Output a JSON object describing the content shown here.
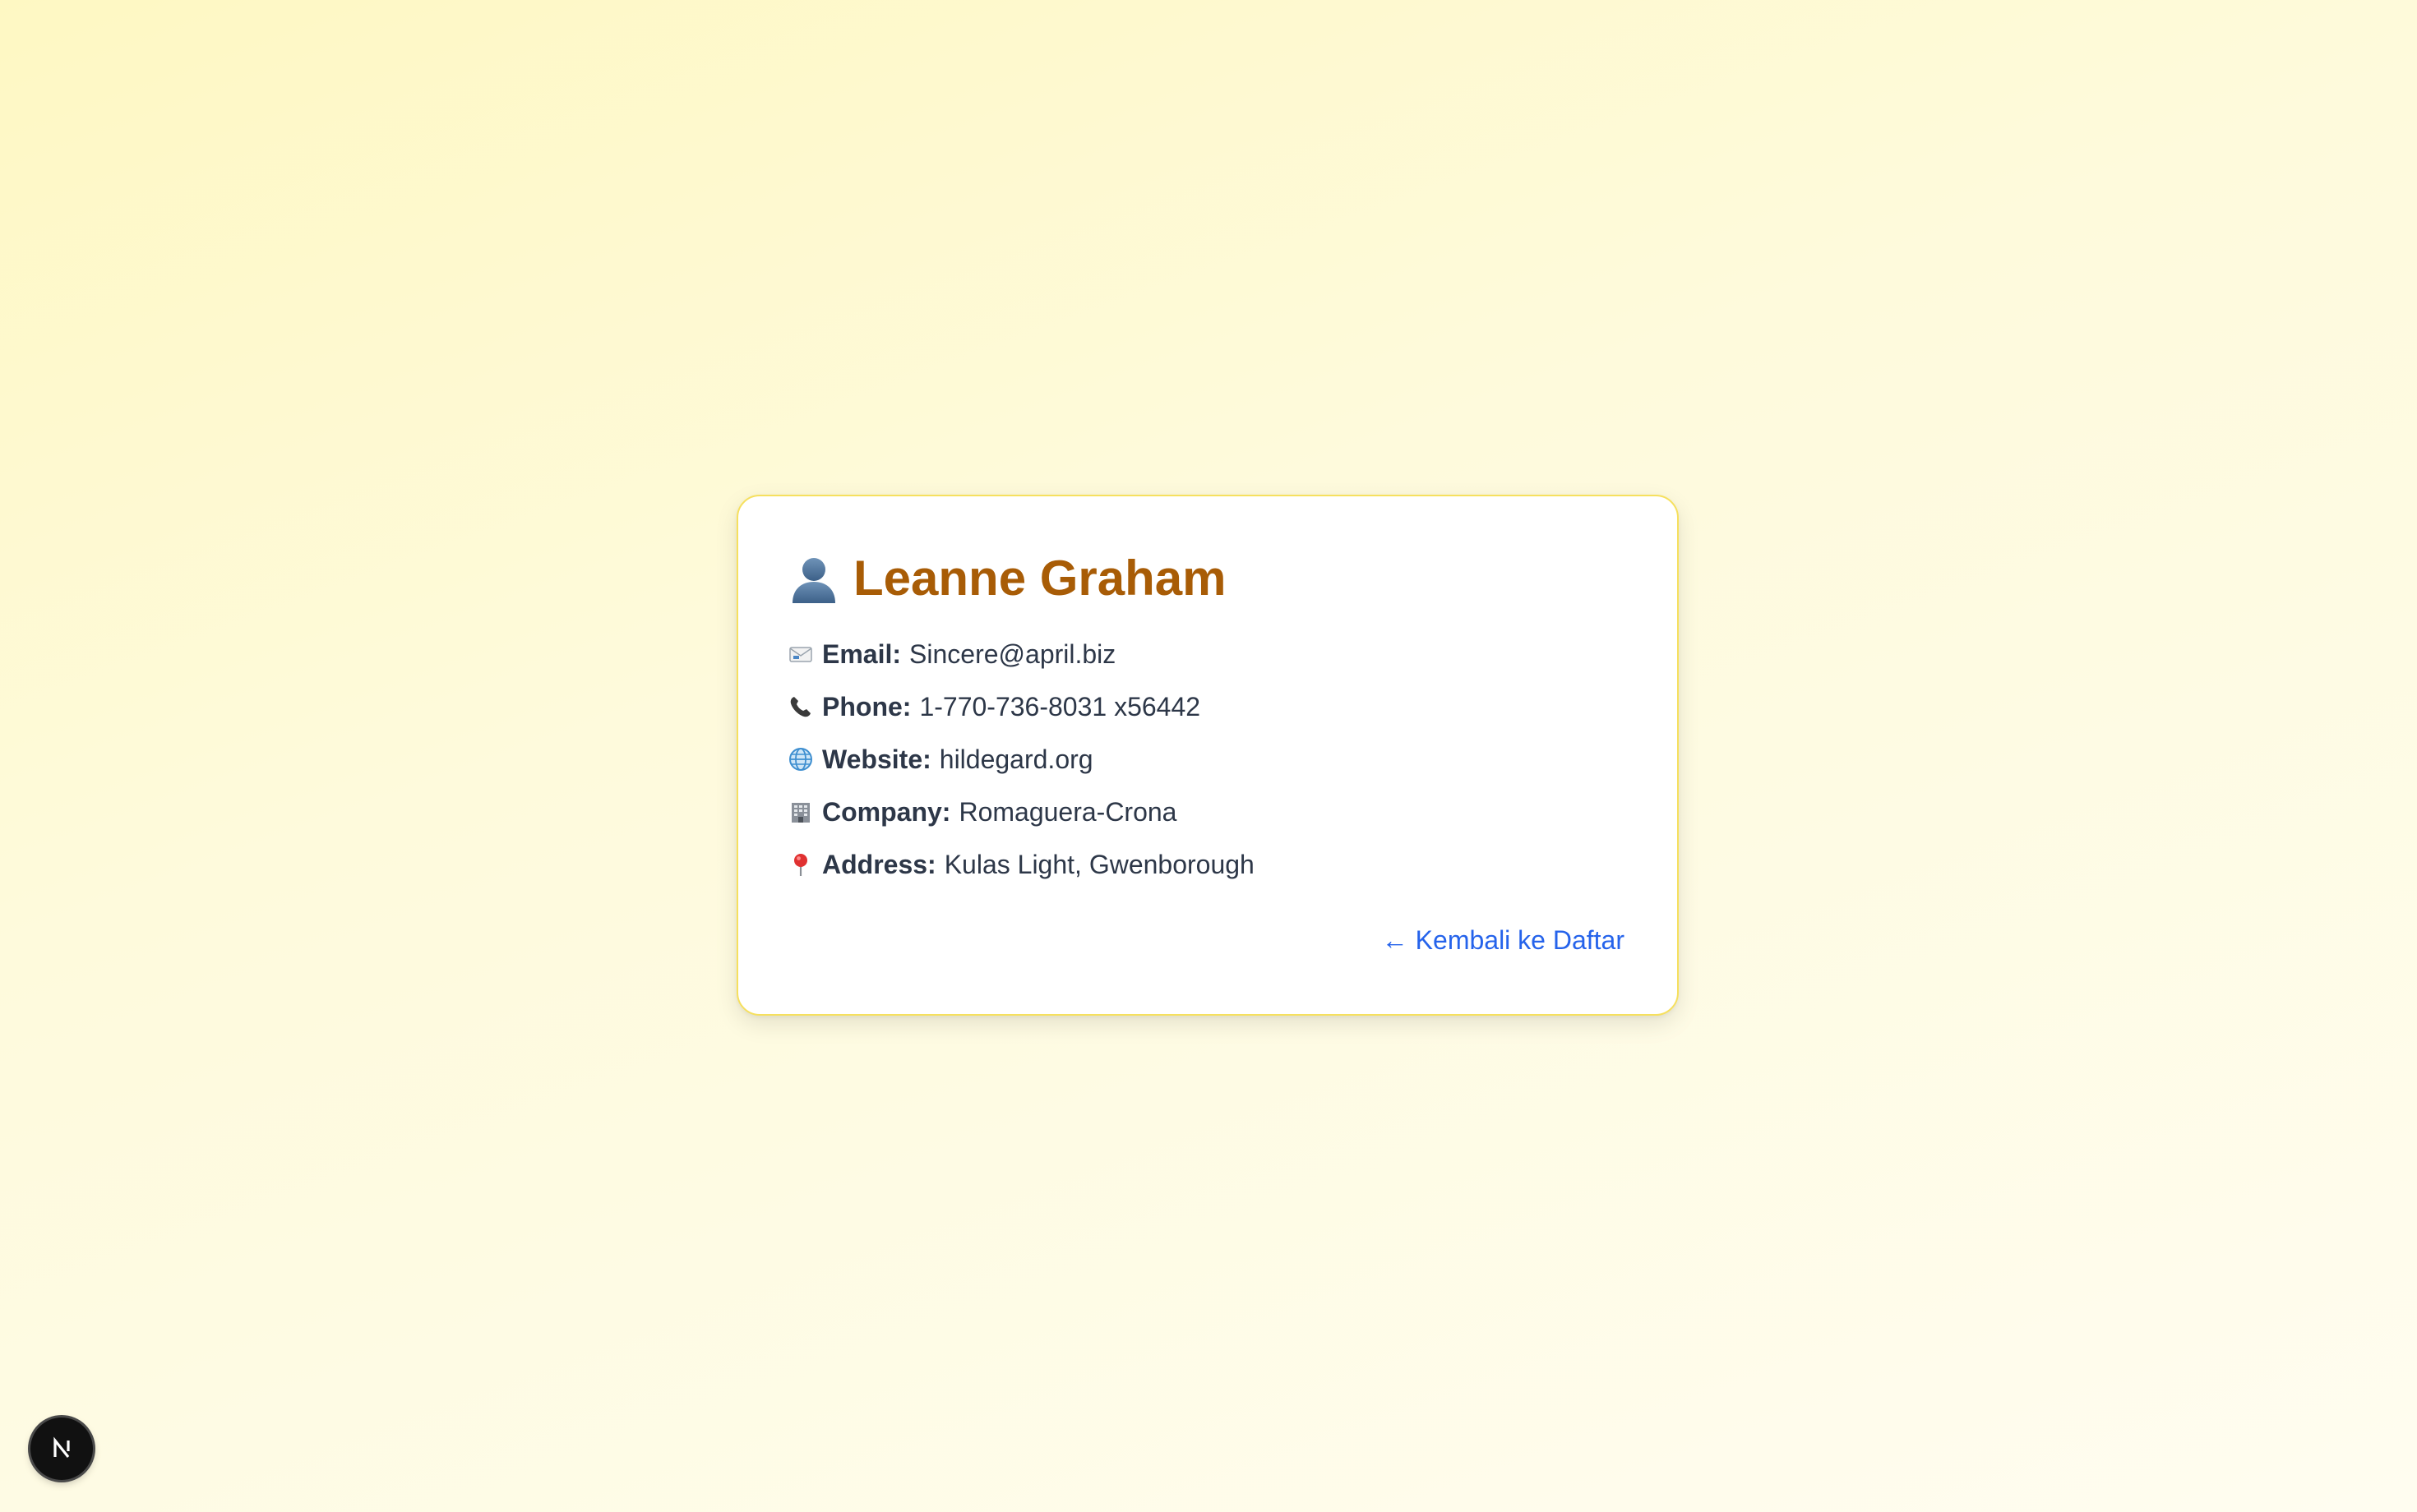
{
  "profile": {
    "name": "Leanne Graham",
    "avatar_icon": "user-silhouette-icon",
    "fields": [
      {
        "icon": "envelope-icon",
        "label": "Email:",
        "value": "Sincere@april.biz"
      },
      {
        "icon": "phone-icon",
        "label": "Phone:",
        "value": "1-770-736-8031 x56442"
      },
      {
        "icon": "globe-icon",
        "label": "Website:",
        "value": "hildegard.org"
      },
      {
        "icon": "office-building-icon",
        "label": "Company:",
        "value": "Romaguera-Crona"
      },
      {
        "icon": "pushpin-icon",
        "label": "Address:",
        "value": "Kulas Light, Gwenborough"
      }
    ],
    "back_link": "← Kembali ke Daftar"
  },
  "dev_badge": {
    "icon": "nextjs-logo-icon"
  },
  "colors": {
    "title": "#a85c06",
    "text": "#2d3748",
    "link": "#2563eb",
    "card_border": "#f6e05e",
    "background": "#fef8c3"
  }
}
